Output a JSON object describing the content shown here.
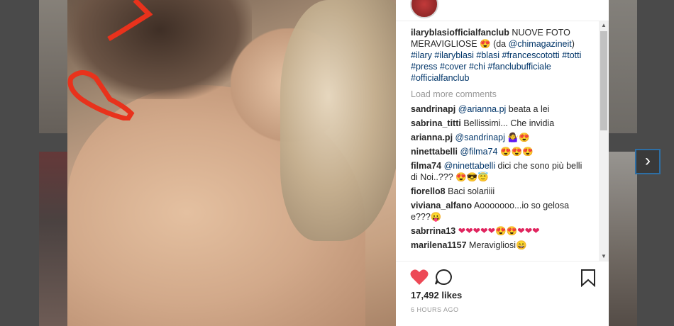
{
  "caption": {
    "username": "ilaryblasiofficialfanclub",
    "text": " NUOVE FOTO MERAVIGLIOSE ",
    "emoji": "😍",
    "credit_open": " (da ",
    "credit_tag": "@chimagazineit",
    "credit_close": ")",
    "hashtags": "#ilary #ilaryblasi #blasi #francescototti #totti #press #cover #chi #fanclubufficiale #officialfanclub"
  },
  "load_more_label": "Load more comments",
  "comments": [
    {
      "user": "sandrinapj",
      "tag": "@arianna.pj",
      "text": " beata a lei",
      "emoji": ""
    },
    {
      "user": "sabrina_titti",
      "tag": "",
      "text": "Bellissimi... Che invidia",
      "emoji": ""
    },
    {
      "user": "arianna.pj",
      "tag": "@sandrinapj",
      "text": " ",
      "emoji": "🤷‍♀️😍"
    },
    {
      "user": "ninettabelli",
      "tag": "@filma74",
      "text": " ",
      "emoji": "😍😍😍"
    },
    {
      "user": "filma74",
      "tag": "@ninettabelli",
      "text": " dici che sono più belli di Noi..??? ",
      "emoji": "😍😎😇"
    },
    {
      "user": "fiorello8",
      "tag": "",
      "text": "Baci solariiii",
      "emoji": ""
    },
    {
      "user": "viviana_alfano",
      "tag": "",
      "text": "Aooooooo...io so gelosa e???",
      "emoji": "😛"
    },
    {
      "user": "sabrrina13",
      "tag": "",
      "text": " ",
      "emoji": "❤❤❤❤❤😍😍❤❤❤"
    },
    {
      "user": "marilena1157",
      "tag": "",
      "text": "Meravigliosi",
      "emoji": "😄"
    }
  ],
  "likes_label": "17,492 likes",
  "time_ago": "6 HOURS AGO",
  "next_arrow": "›",
  "scroll_up": "▲",
  "scroll_down": "▼",
  "icons": {
    "like": "heart-icon",
    "comment": "comment-icon",
    "save": "bookmark-icon",
    "next": "chevron-right-icon"
  },
  "colors": {
    "like_red": "#ed4956",
    "link_blue": "#003569",
    "muted_gray": "#999999"
  }
}
